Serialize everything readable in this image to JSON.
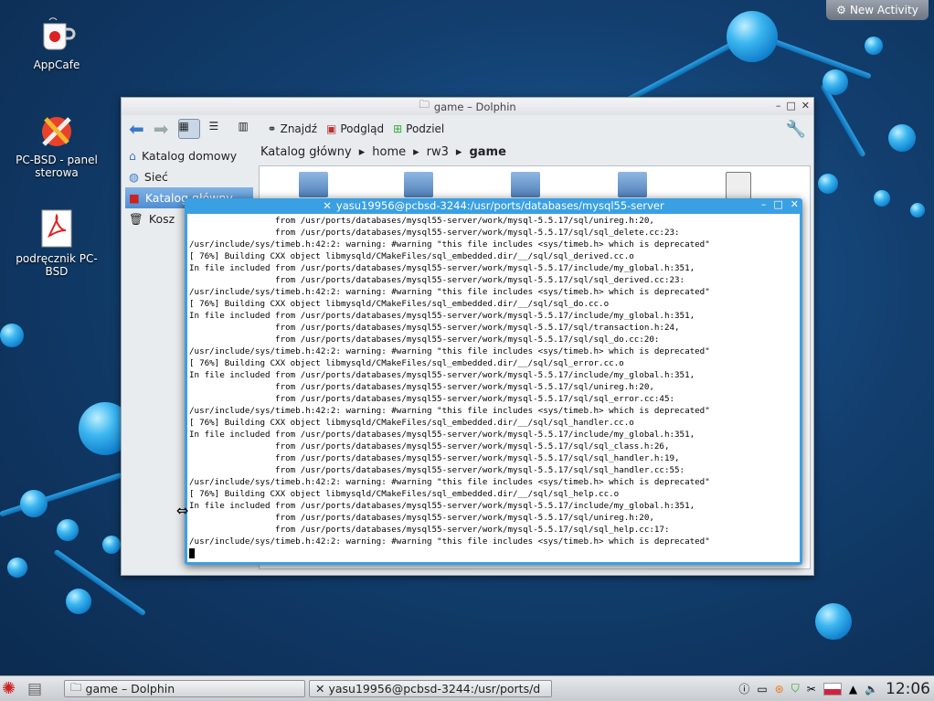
{
  "desktop": {
    "new_activity": "New Activity",
    "icons": [
      {
        "label": "AppCafe"
      },
      {
        "label": "PC-BSD - panel sterowa"
      },
      {
        "label": "podręcznik PC-BSD"
      }
    ]
  },
  "dolphin": {
    "title": "game – Dolphin",
    "toolbar": {
      "find": "Znajdź",
      "preview": "Podgląd",
      "split": "Podziel"
    },
    "sidebar": [
      {
        "label": "Katalog domowy",
        "icon": "home-icon"
      },
      {
        "label": "Sieć",
        "icon": "network-icon"
      },
      {
        "label": "Katalog główny",
        "icon": "root-folder-icon",
        "selected": true
      },
      {
        "label": "Kosz",
        "icon": "trash-icon"
      }
    ],
    "breadcrumb": [
      "Katalog główny",
      "home",
      "rw3",
      "game"
    ]
  },
  "terminal": {
    "title": "yasu19956@pcbsd-3244:/usr/ports/databases/mysql55-server",
    "lines": [
      "                 from /usr/ports/databases/mysql55-server/work/mysql-5.5.17/sql/unireg.h:20,",
      "                 from /usr/ports/databases/mysql55-server/work/mysql-5.5.17/sql/sql_delete.cc:23:",
      "/usr/include/sys/timeb.h:42:2: warning: #warning \"this file includes <sys/timeb.h> which is deprecated\"",
      "[ 76%] Building CXX object libmysqld/CMakeFiles/sql_embedded.dir/__/sql/sql_derived.cc.o",
      "In file included from /usr/ports/databases/mysql55-server/work/mysql-5.5.17/include/my_global.h:351,",
      "                 from /usr/ports/databases/mysql55-server/work/mysql-5.5.17/sql/sql_derived.cc:23:",
      "/usr/include/sys/timeb.h:42:2: warning: #warning \"this file includes <sys/timeb.h> which is deprecated\"",
      "[ 76%] Building CXX object libmysqld/CMakeFiles/sql_embedded.dir/__/sql/sql_do.cc.o",
      "In file included from /usr/ports/databases/mysql55-server/work/mysql-5.5.17/include/my_global.h:351,",
      "                 from /usr/ports/databases/mysql55-server/work/mysql-5.5.17/sql/transaction.h:24,",
      "                 from /usr/ports/databases/mysql55-server/work/mysql-5.5.17/sql/sql_do.cc:20:",
      "/usr/include/sys/timeb.h:42:2: warning: #warning \"this file includes <sys/timeb.h> which is deprecated\"",
      "[ 76%] Building CXX object libmysqld/CMakeFiles/sql_embedded.dir/__/sql/sql_error.cc.o",
      "In file included from /usr/ports/databases/mysql55-server/work/mysql-5.5.17/include/my_global.h:351,",
      "                 from /usr/ports/databases/mysql55-server/work/mysql-5.5.17/sql/unireg.h:20,",
      "                 from /usr/ports/databases/mysql55-server/work/mysql-5.5.17/sql/sql_error.cc:45:",
      "/usr/include/sys/timeb.h:42:2: warning: #warning \"this file includes <sys/timeb.h> which is deprecated\"",
      "[ 76%] Building CXX object libmysqld/CMakeFiles/sql_embedded.dir/__/sql/sql_handler.cc.o",
      "In file included from /usr/ports/databases/mysql55-server/work/mysql-5.5.17/include/my_global.h:351,",
      "                 from /usr/ports/databases/mysql55-server/work/mysql-5.5.17/sql/sql_class.h:26,",
      "                 from /usr/ports/databases/mysql55-server/work/mysql-5.5.17/sql/sql_handler.h:19,",
      "                 from /usr/ports/databases/mysql55-server/work/mysql-5.5.17/sql/sql_handler.cc:55:",
      "/usr/include/sys/timeb.h:42:2: warning: #warning \"this file includes <sys/timeb.h> which is deprecated\"",
      "[ 76%] Building CXX object libmysqld/CMakeFiles/sql_embedded.dir/__/sql/sql_help.cc.o",
      "In file included from /usr/ports/databases/mysql55-server/work/mysql-5.5.17/include/my_global.h:351,",
      "                 from /usr/ports/databases/mysql55-server/work/mysql-5.5.17/sql/unireg.h:20,",
      "                 from /usr/ports/databases/mysql55-server/work/mysql-5.5.17/sql/sql_help.cc:17:",
      "/usr/include/sys/timeb.h:42:2: warning: #warning \"this file includes <sys/timeb.h> which is deprecated\""
    ]
  },
  "taskbar": {
    "tasks": [
      {
        "label": "game – Dolphin"
      },
      {
        "label": "yasu19956@pcbsd-3244:/usr/ports/d"
      }
    ],
    "clock": "12:06"
  }
}
